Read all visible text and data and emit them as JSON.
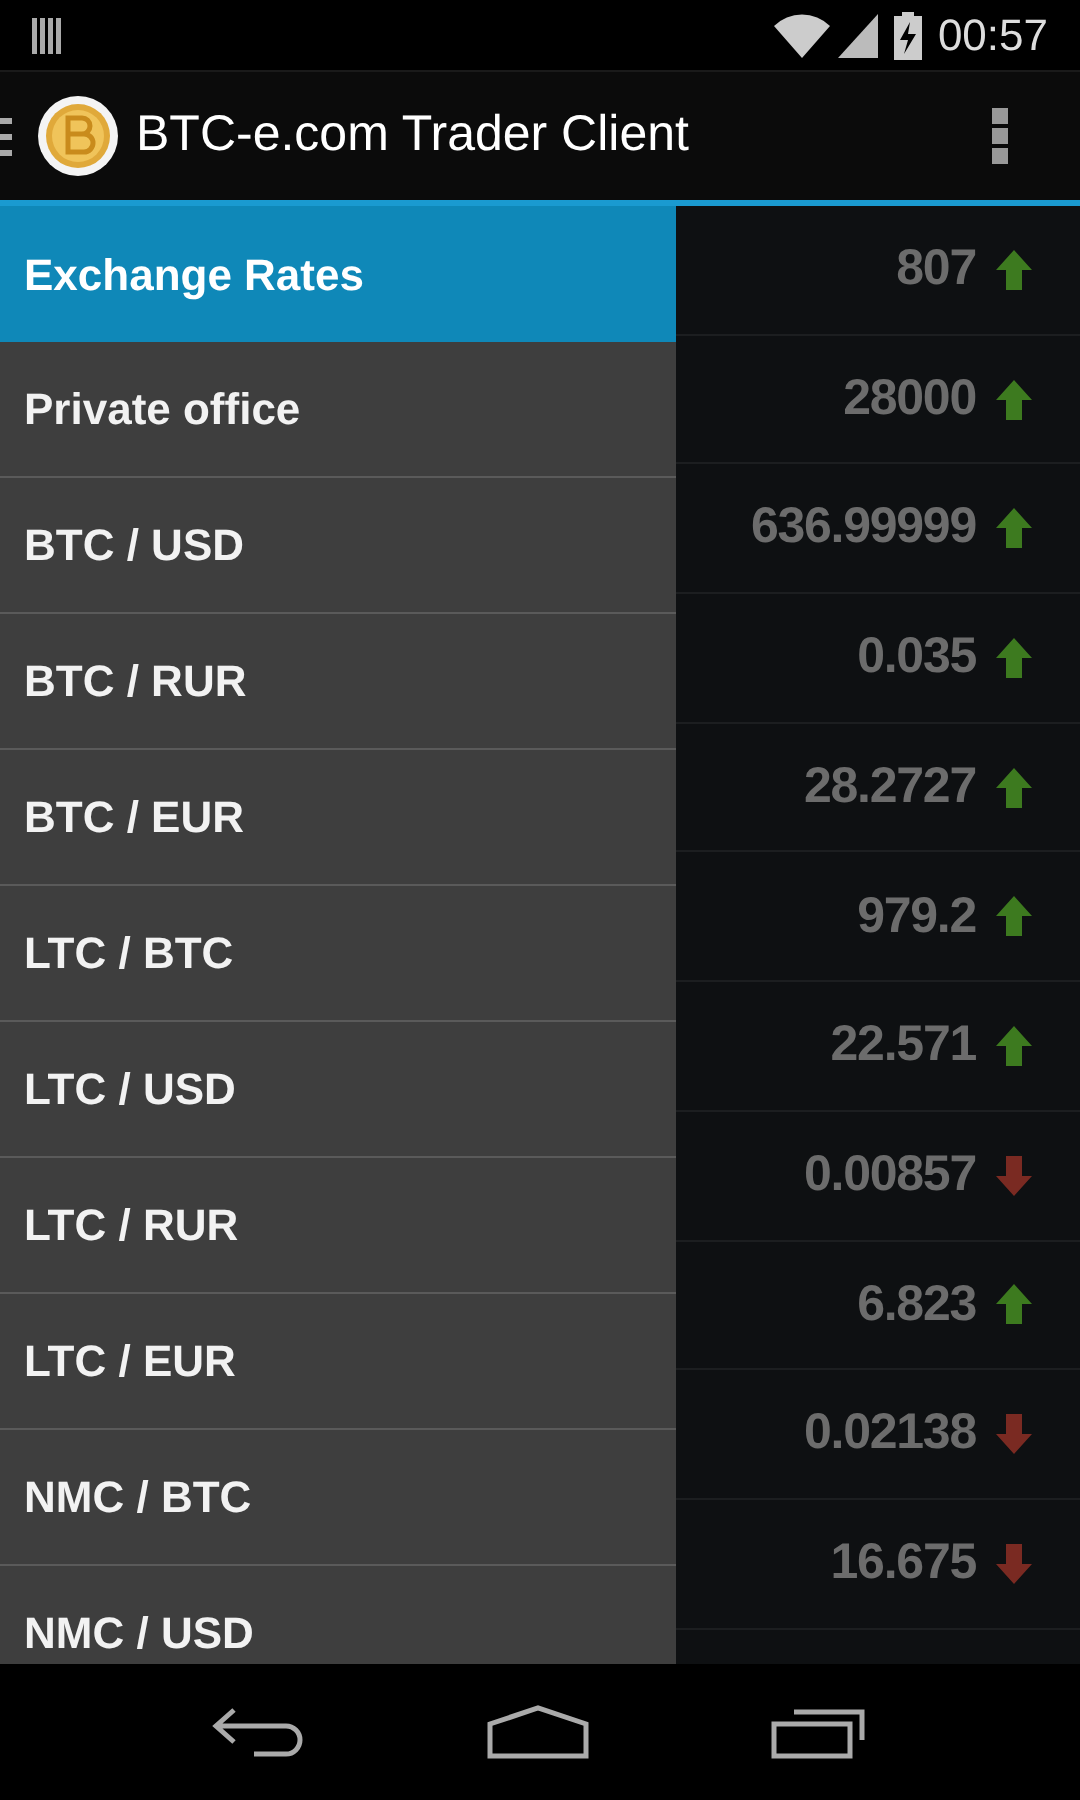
{
  "status_bar": {
    "time": "00:57"
  },
  "action_bar": {
    "title": "BTC-e.com Trader Client"
  },
  "drawer": {
    "items": [
      {
        "label": "Exchange Rates",
        "selected": true
      },
      {
        "label": "Private office",
        "selected": false
      },
      {
        "label": "BTC / USD",
        "selected": false
      },
      {
        "label": "BTC / RUR",
        "selected": false
      },
      {
        "label": "BTC / EUR",
        "selected": false
      },
      {
        "label": "LTC / BTC",
        "selected": false
      },
      {
        "label": "LTC / USD",
        "selected": false
      },
      {
        "label": "LTC / RUR",
        "selected": false
      },
      {
        "label": "LTC / EUR",
        "selected": false
      },
      {
        "label": "NMC / BTC",
        "selected": false
      },
      {
        "label": "NMC / USD",
        "selected": false
      }
    ]
  },
  "rates": [
    {
      "value": "807",
      "kind": "up"
    },
    {
      "value": "28000",
      "kind": "up"
    },
    {
      "value": "636.99999",
      "kind": "up"
    },
    {
      "value": "0.035",
      "kind": "up"
    },
    {
      "value": "28.2727",
      "kind": "up"
    },
    {
      "value": "979.2",
      "kind": "up"
    },
    {
      "value": "22.571",
      "kind": "up"
    },
    {
      "value": "0.00857",
      "kind": "down"
    },
    {
      "value": "6.823",
      "kind": "up"
    },
    {
      "value": "0.02138",
      "kind": "down"
    },
    {
      "value": "16.675",
      "kind": "down"
    }
  ]
}
